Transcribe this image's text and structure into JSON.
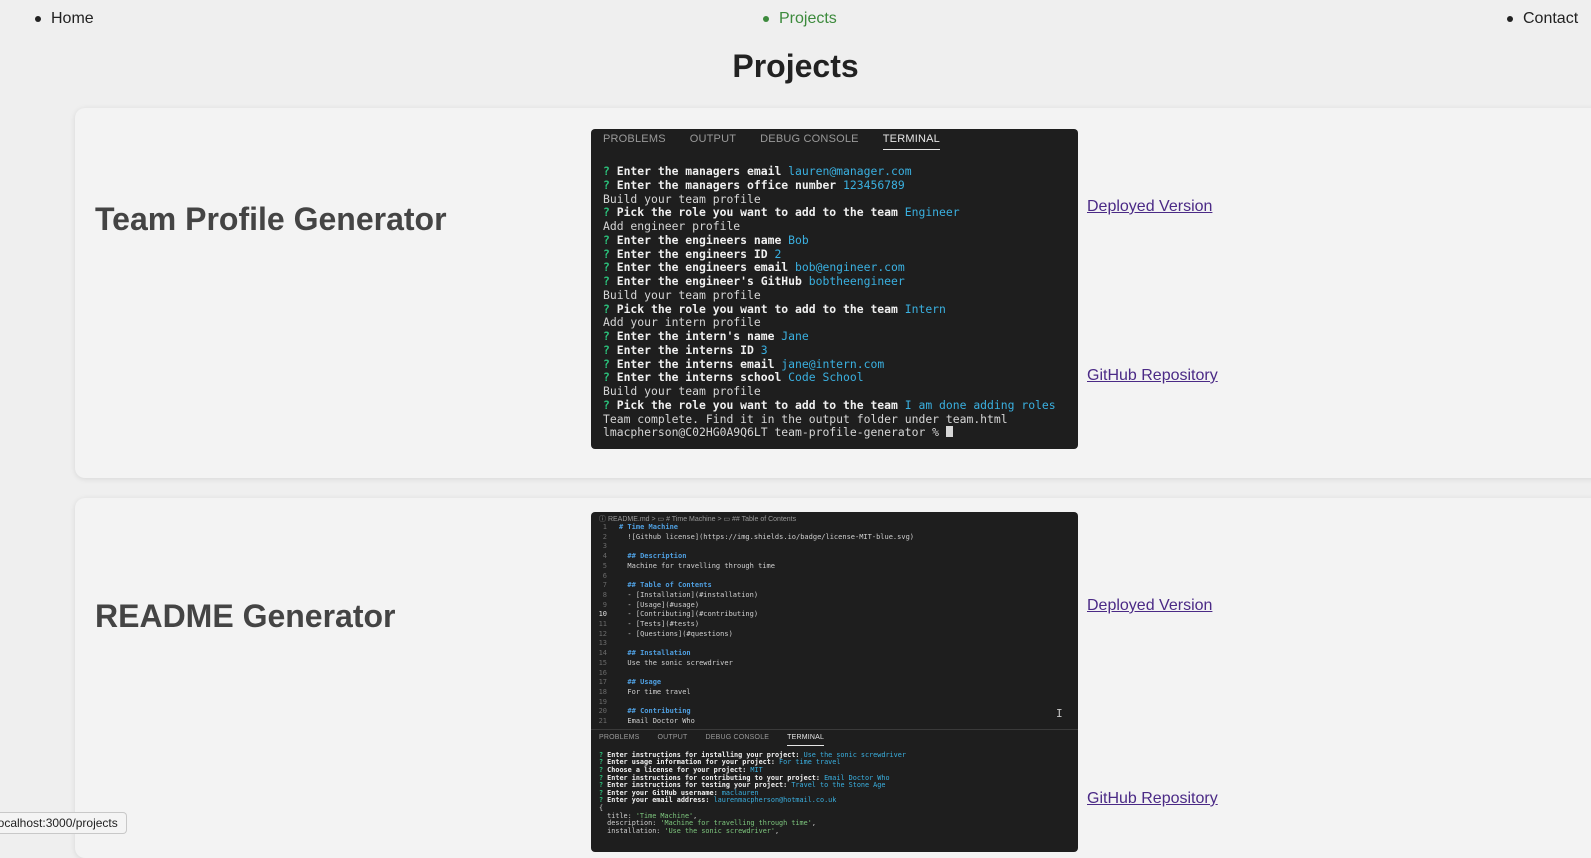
{
  "nav": {
    "home": "Home",
    "projects": "Projects",
    "contact": "Contact"
  },
  "page_title": "Projects",
  "projects": [
    {
      "title": "Team Profile Generator",
      "deployed_label": "Deployed Version",
      "repo_label": "GitHub Repository",
      "screenshot": {
        "tabs": [
          "PROBLEMS",
          "OUTPUT",
          "DEBUG CONSOLE",
          "TERMINAL"
        ],
        "active_tab": "TERMINAL",
        "lines": [
          {
            "q": "?",
            "bold": " Enter the managers email",
            "val": " lauren@manager.com"
          },
          {
            "q": "?",
            "bold": " Enter the managers office number",
            "val": " 123456789"
          },
          {
            "text": "Build your team profile"
          },
          {
            "q": "?",
            "bold": " Pick the role you want to add to the team",
            "val": " Engineer"
          },
          {
            "text": "Add engineer profile"
          },
          {
            "q": "?",
            "bold": " Enter the engineers name",
            "val": " Bob"
          },
          {
            "q": "?",
            "bold": " Enter the engineers ID",
            "val": " 2"
          },
          {
            "q": "?",
            "bold": " Enter the engineers email",
            "val": " bob@engineer.com"
          },
          {
            "q": "?",
            "bold": " Enter the engineer's GitHub",
            "val": " bobtheengineer"
          },
          {
            "text": "Build your team profile"
          },
          {
            "q": "?",
            "bold": " Pick the role you want to add to the team",
            "val": " Intern"
          },
          {
            "text": "Add your intern profile"
          },
          {
            "q": "?",
            "bold": " Enter the intern's name",
            "val": " Jane"
          },
          {
            "q": "?",
            "bold": " Enter the interns ID",
            "val": " 3"
          },
          {
            "q": "?",
            "bold": " Enter the interns email",
            "val": " jane@intern.com"
          },
          {
            "q": "?",
            "bold": " Enter the interns school",
            "val": " Code School"
          },
          {
            "text": "Build your team profile"
          },
          {
            "q": "?",
            "bold": " Pick the role you want to add to the team",
            "val": " I am done adding roles"
          },
          {
            "text": "Team complete. Find it in the output folder under team.html"
          },
          {
            "text": "lmacpherson@C02HG0A9Q6LT team-profile-generator % "
          }
        ]
      }
    },
    {
      "title": "README Generator",
      "deployed_label": "Deployed Version",
      "repo_label": "GitHub Repository",
      "screenshot": {
        "breadcrumb": "ⓘ README.md > ▭ # Time Machine > ▭ ## Table of Contents",
        "code_lines": [
          {
            "n": "1",
            "text": "# Time Machine",
            "h": true
          },
          {
            "n": "2",
            "text": "  ![Github license](https://img.shields.io/badge/license-MIT-blue.svg)"
          },
          {
            "n": "3",
            "text": ""
          },
          {
            "n": "4",
            "text": "  ## Description",
            "h": true
          },
          {
            "n": "5",
            "text": "  Machine for travelling through time"
          },
          {
            "n": "6",
            "text": ""
          },
          {
            "n": "7",
            "text": "  ## Table of Contents",
            "h": true
          },
          {
            "n": "8",
            "text": "  - [Installation](#installation)"
          },
          {
            "n": "9",
            "text": "  - [Usage](#usage)"
          },
          {
            "n": "10",
            "text": "  - [Contributing](#contributing)",
            "cur": true
          },
          {
            "n": "11",
            "text": "  - [Tests](#tests)"
          },
          {
            "n": "12",
            "text": "  - [Questions](#questions)"
          },
          {
            "n": "13",
            "text": ""
          },
          {
            "n": "14",
            "text": "  ## Installation",
            "h": true
          },
          {
            "n": "15",
            "text": "  Use the sonic screwdriver"
          },
          {
            "n": "16",
            "text": ""
          },
          {
            "n": "17",
            "text": "  ## Usage",
            "h": true
          },
          {
            "n": "18",
            "text": "  For time travel"
          },
          {
            "n": "19",
            "text": ""
          },
          {
            "n": "20",
            "text": "  ## Contributing",
            "h": true
          },
          {
            "n": "21",
            "text": "  Email Doctor Who"
          }
        ],
        "tabs": [
          "PROBLEMS",
          "OUTPUT",
          "DEBUG CONSOLE",
          "TERMINAL"
        ],
        "term_lines": [
          {
            "q": "?",
            "bold": " Enter instructions for installing your project:",
            "val": " Use the sonic screwdriver"
          },
          {
            "q": "?",
            "bold": " Enter usage information for your project:",
            "val": " For time travel"
          },
          {
            "q": "?",
            "bold": " Choose a license for your project:",
            "val": " MIT"
          },
          {
            "q": "?",
            "bold": " Enter instructions for contributing to your project:",
            "val": " Email Doctor Who"
          },
          {
            "q": "?",
            "bold": " Enter instructions for testing your project:",
            "val": " Travel to the Stone Age"
          },
          {
            "q": "?",
            "bold": " Enter your GitHub username:",
            "val": " maclauren"
          },
          {
            "q": "?",
            "bold": " Enter your email address:",
            "val": " laurenmacpherson@hotmail.co.uk"
          },
          {
            "text": "{"
          },
          {
            "text": "  title: ",
            "str": "'Time Machine'",
            "tail": ","
          },
          {
            "text": "  description: ",
            "str": "'Machine for travelling through time'",
            "tail": ","
          },
          {
            "text": "  installation: ",
            "str": "'Use the sonic screwdriver'",
            "tail": ","
          }
        ]
      }
    }
  ],
  "status_bar": "localhost:3000/projects"
}
